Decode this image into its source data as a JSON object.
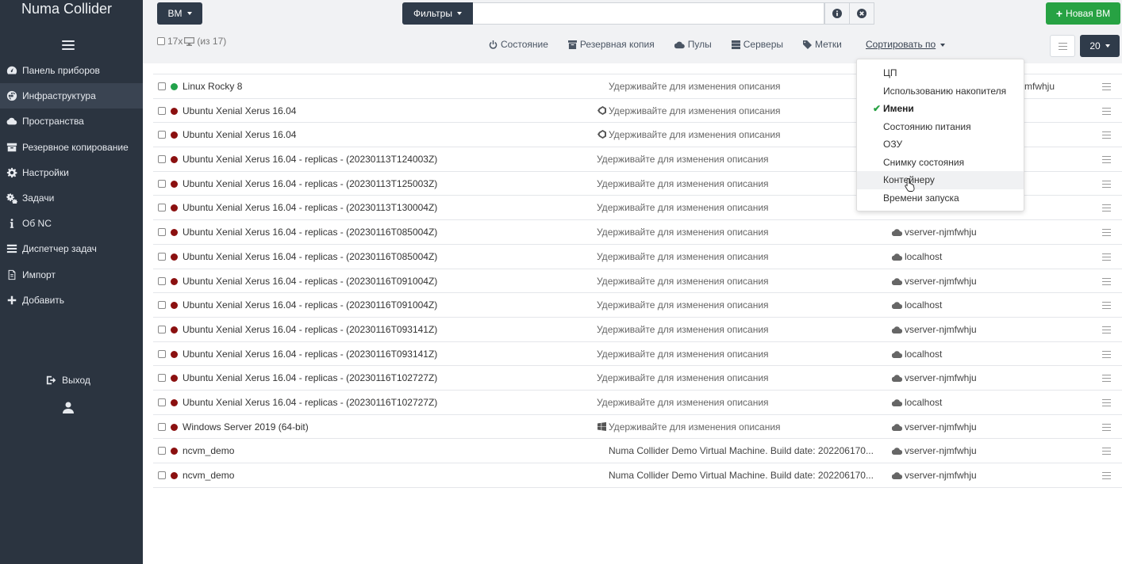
{
  "app": {
    "title": "Numa Collider"
  },
  "sidebar": {
    "items": [
      {
        "label": "Панель приборов",
        "icon": "dashboard-icon"
      },
      {
        "label": "Инфраструктура",
        "icon": "globe-icon"
      },
      {
        "label": "Пространства",
        "icon": "cloud-icon"
      },
      {
        "label": "Резервное копирование",
        "icon": "archive-icon"
      },
      {
        "label": "Настройки",
        "icon": "gear-icon"
      },
      {
        "label": "Задачи",
        "icon": "gears-icon"
      },
      {
        "label": "Об NC",
        "icon": "info-icon"
      },
      {
        "label": "Диспетчер задач",
        "icon": "tasks-icon"
      },
      {
        "label": "Импорт",
        "icon": "import-icon"
      },
      {
        "label": "Добавить",
        "icon": "plus-icon"
      }
    ],
    "logout": "Выход",
    "active_index": 1
  },
  "topbar": {
    "vm_button": "ВМ",
    "filters_button": "Фильтры",
    "search_value": "",
    "new_vm_button": "Новая ВМ",
    "selection_count": "17x",
    "selection_total": "(из 17)",
    "toolbar": {
      "state": "Состояние",
      "backup": "Резервная копия",
      "pools": "Пулы",
      "servers": "Серверы",
      "tags": "Метки"
    },
    "sort_by": "Сортировать по",
    "page_size": "20"
  },
  "sort_menu": {
    "items": [
      "ЦП",
      "Использованию накопителя",
      "Имени",
      "Состоянию питания",
      "ОЗУ",
      "Снимку состояния",
      "Контейнеру",
      "Времени запуска"
    ],
    "selected": "Имени",
    "hovered": "Контейнеру"
  },
  "colors": {
    "running": "#22a24a",
    "halted": "#8b1010",
    "accent": "#27a243",
    "sidebar_bg": "#2b3440"
  },
  "rows": [
    {
      "name": "Linux Rocky 8",
      "state": "running",
      "desc": "Удерживайте для изменения описания",
      "os": "",
      "host": "mfwhju"
    },
    {
      "name": "Ubuntu Xenial Xerus 16.04",
      "state": "halted",
      "desc": "Удерживайте для изменения описания",
      "os": "linux",
      "host": ""
    },
    {
      "name": "Ubuntu Xenial Xerus 16.04",
      "state": "halted",
      "desc": "Удерживайте для изменения описания",
      "os": "linux",
      "host": ""
    },
    {
      "name": "Ubuntu Xenial Xerus 16.04 - replicas - (20230113T124003Z)",
      "state": "halted",
      "desc": "Удерживайте для изменения описания",
      "os": "",
      "host": ""
    },
    {
      "name": "Ubuntu Xenial Xerus 16.04 - replicas - (20230113T125003Z)",
      "state": "halted",
      "desc": "Удерживайте для изменения описания",
      "os": "",
      "host": ""
    },
    {
      "name": "Ubuntu Xenial Xerus 16.04 - replicas - (20230113T130004Z)",
      "state": "halted",
      "desc": "Удерживайте для изменения описания",
      "os": "",
      "host": ""
    },
    {
      "name": "Ubuntu Xenial Xerus 16.04 - replicas - (20230116T085004Z)",
      "state": "halted",
      "desc": "Удерживайте для изменения описания",
      "os": "",
      "host": "vserver-njmfwhju"
    },
    {
      "name": "Ubuntu Xenial Xerus 16.04 - replicas - (20230116T085004Z)",
      "state": "halted",
      "desc": "Удерживайте для изменения описания",
      "os": "",
      "host": "localhost"
    },
    {
      "name": "Ubuntu Xenial Xerus 16.04 - replicas - (20230116T091004Z)",
      "state": "halted",
      "desc": "Удерживайте для изменения описания",
      "os": "",
      "host": "vserver-njmfwhju"
    },
    {
      "name": "Ubuntu Xenial Xerus 16.04 - replicas - (20230116T091004Z)",
      "state": "halted",
      "desc": "Удерживайте для изменения описания",
      "os": "",
      "host": "localhost"
    },
    {
      "name": "Ubuntu Xenial Xerus 16.04 - replicas - (20230116T093141Z)",
      "state": "halted",
      "desc": "Удерживайте для изменения описания",
      "os": "",
      "host": "vserver-njmfwhju"
    },
    {
      "name": "Ubuntu Xenial Xerus 16.04 - replicas - (20230116T093141Z)",
      "state": "halted",
      "desc": "Удерживайте для изменения описания",
      "os": "",
      "host": "localhost"
    },
    {
      "name": "Ubuntu Xenial Xerus 16.04 - replicas - (20230116T102727Z)",
      "state": "halted",
      "desc": "Удерживайте для изменения описания",
      "os": "",
      "host": "vserver-njmfwhju"
    },
    {
      "name": "Ubuntu Xenial Xerus 16.04 - replicas - (20230116T102727Z)",
      "state": "halted",
      "desc": "Удерживайте для изменения описания",
      "os": "",
      "host": "localhost"
    },
    {
      "name": "Windows Server 2019 (64-bit)",
      "state": "halted",
      "desc": "Удерживайте для изменения описания",
      "os": "windows",
      "host": "vserver-njmfwhju"
    },
    {
      "name": "ncvm_demo",
      "state": "halted",
      "desc": "Numa Collider Demo Virtual Machine. Build date: 202206170...",
      "os": "",
      "host": "vserver-njmfwhju"
    },
    {
      "name": "ncvm_demo",
      "state": "halted",
      "desc": "Numa Collider Demo Virtual Machine. Build date: 202206170...",
      "os": "",
      "host": "vserver-njmfwhju"
    }
  ]
}
